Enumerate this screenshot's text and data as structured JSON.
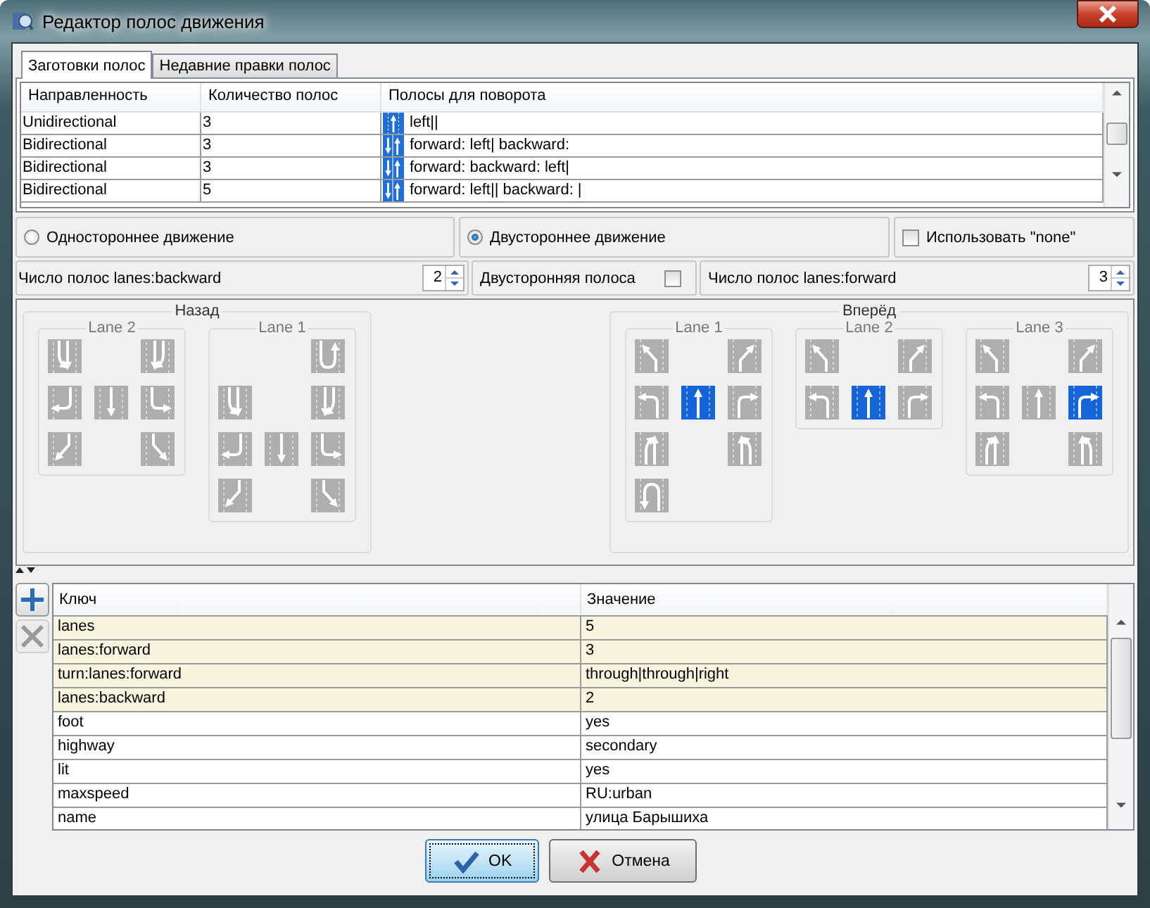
{
  "window": {
    "title": "Редактор полос движения"
  },
  "tabs": [
    {
      "label": "Заготовки полос",
      "selected": true
    },
    {
      "label": "Недавние правки полос",
      "selected": false
    }
  ],
  "presets": {
    "columns": [
      "Направленность",
      "Количество полос",
      "Полосы для поворота"
    ],
    "rows": [
      {
        "directionality": "Unidirectional",
        "lane_count": "3",
        "turn_lanes": "left||",
        "kind": "oneway"
      },
      {
        "directionality": "Bidirectional",
        "lane_count": "3",
        "turn_lanes": "forward: left| backward:",
        "kind": "twoway"
      },
      {
        "directionality": "Bidirectional",
        "lane_count": "3",
        "turn_lanes": "forward:  backward: left|",
        "kind": "twoway"
      },
      {
        "directionality": "Bidirectional",
        "lane_count": "5",
        "turn_lanes": "forward: left|| backward: |",
        "kind": "twoway"
      }
    ]
  },
  "direction_options": [
    {
      "label": "Одностороннее движение",
      "selected": false
    },
    {
      "label": "Двустороннее движение",
      "selected": true
    }
  ],
  "use_none": {
    "label": "Использовать \"none\"",
    "checked": false
  },
  "backward_count": {
    "label": "Число полос lanes:backward",
    "value": "2"
  },
  "both_way_lane": {
    "label": "Двусторонняя полоса",
    "checked": false
  },
  "forward_count": {
    "label": "Число полос lanes:forward",
    "value": "3"
  },
  "lane_sections": [
    {
      "title": "Назад",
      "kind": "backward",
      "lanes": [
        {
          "title": "Lane 2",
          "arrows": [
            {
              "kind": "slight_left",
              "selected": false
            },
            {
              "kind": "slight_right",
              "selected": false
            },
            {
              "kind": "left",
              "selected": false
            },
            {
              "kind": "through",
              "selected": false
            },
            {
              "kind": "right",
              "selected": false
            },
            {
              "kind": "merge_left",
              "selected": false
            },
            {
              "kind": "merge_right",
              "selected": false
            }
          ]
        },
        {
          "title": "Lane 1",
          "arrows": [
            {
              "kind": "slight_left",
              "selected": false
            },
            {
              "kind": "slight_right",
              "selected": false
            },
            {
              "kind": "left",
              "selected": false
            },
            {
              "kind": "through",
              "selected": false
            },
            {
              "kind": "right",
              "selected": false
            },
            {
              "kind": "merge_left",
              "selected": false
            },
            {
              "kind": "merge_right",
              "selected": false
            },
            {
              "kind": "reverse",
              "selected": false
            }
          ]
        }
      ]
    },
    {
      "title": "Вперёд",
      "kind": "forward",
      "lanes": [
        {
          "title": "Lane 1",
          "arrows": [
            {
              "kind": "slight_left",
              "selected": false
            },
            {
              "kind": "slight_right",
              "selected": false
            },
            {
              "kind": "left",
              "selected": false
            },
            {
              "kind": "through",
              "selected": true
            },
            {
              "kind": "right",
              "selected": false
            },
            {
              "kind": "merge_left",
              "selected": false
            },
            {
              "kind": "merge_right",
              "selected": false
            },
            {
              "kind": "reverse",
              "selected": false
            }
          ]
        },
        {
          "title": "Lane 2",
          "arrows": [
            {
              "kind": "slight_left",
              "selected": false
            },
            {
              "kind": "slight_right",
              "selected": false
            },
            {
              "kind": "left",
              "selected": false
            },
            {
              "kind": "through",
              "selected": true
            },
            {
              "kind": "right",
              "selected": false
            }
          ]
        },
        {
          "title": "Lane 3",
          "arrows": [
            {
              "kind": "slight_left",
              "selected": false
            },
            {
              "kind": "slight_right",
              "selected": false
            },
            {
              "kind": "left",
              "selected": false
            },
            {
              "kind": "through",
              "selected": false
            },
            {
              "kind": "right",
              "selected": true
            },
            {
              "kind": "merge_left",
              "selected": false
            },
            {
              "kind": "merge_right",
              "selected": false
            }
          ]
        }
      ]
    }
  ],
  "tags": {
    "columns": [
      "Ключ",
      "Значение"
    ],
    "rows": [
      {
        "key": "lanes",
        "value": "5",
        "changed": true
      },
      {
        "key": "lanes:forward",
        "value": "3",
        "changed": true
      },
      {
        "key": "turn:lanes:forward",
        "value": "through|through|right",
        "changed": true
      },
      {
        "key": "lanes:backward",
        "value": "2",
        "changed": true
      },
      {
        "key": "foot",
        "value": "yes",
        "changed": false
      },
      {
        "key": "highway",
        "value": "secondary",
        "changed": false
      },
      {
        "key": "lit",
        "value": "yes",
        "changed": false
      },
      {
        "key": "maxspeed",
        "value": "RU:urban",
        "changed": false
      },
      {
        "key": "name",
        "value": "улица Барышиха",
        "changed": false
      }
    ]
  },
  "buttons": [
    {
      "label": "OK",
      "kind": "ok"
    },
    {
      "label": "Отмена",
      "kind": "cancel"
    }
  ]
}
